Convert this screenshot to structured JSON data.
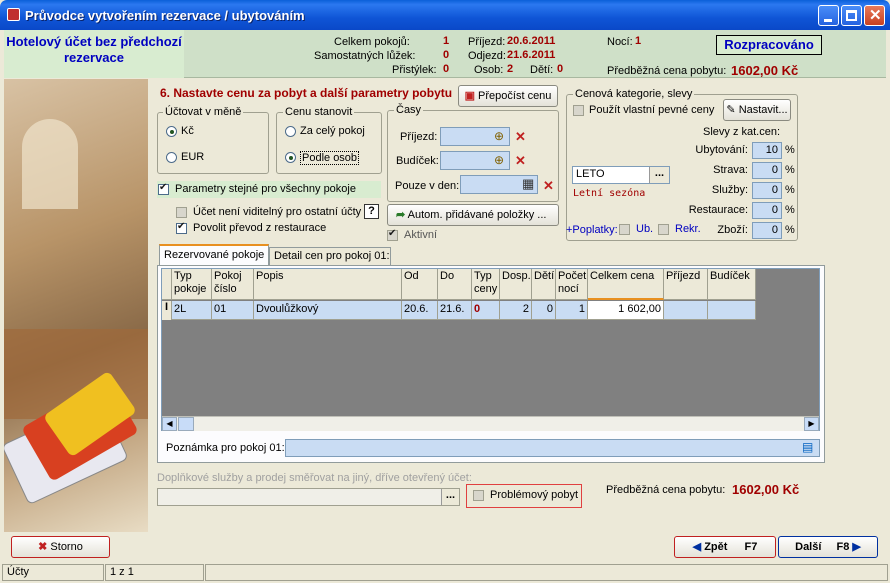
{
  "window": {
    "title": "Průvodce vytvořením rezervace / ubytováním"
  },
  "header": {
    "account_title": "Hotelový účet bez předchozí rezervace",
    "total_rooms_label": "Celkem pokojů:",
    "total_rooms": "1",
    "single_beds_label": "Samostatných lůžek:",
    "single_beds": "0",
    "extra_beds_label": "Přistýlek:",
    "extra_beds": "0",
    "arrival_label": "Příjezd:",
    "arrival": "20.6.2011",
    "departure_label": "Odjezd:",
    "departure": "21.6.2011",
    "persons_label": "Osob:",
    "persons": "2",
    "children_label": "Dětí:",
    "children": "0",
    "nights_label": "Nocí:",
    "nights": "1",
    "status": "Rozpracováno",
    "prelim_price_label": "Předběžná cena pobytu:",
    "prelim_price": "1602,00 Kč"
  },
  "step": {
    "title": "6. Nastavte cenu za pobyt a další parametry pobytu",
    "recalc_button": "Přepočíst cenu"
  },
  "currency": {
    "label": "Účtovat v měně",
    "opt1": "Kč",
    "opt2": "EUR",
    "selected": "Kč"
  },
  "price_set": {
    "label": "Cenu stanovit",
    "opt1": "Za celý pokoj",
    "opt2": "Podle osob",
    "selected": "Podle osob"
  },
  "times": {
    "label": "Časy",
    "arrival_label": "Příjezd:",
    "wakeup_label": "Budíček:",
    "only_day_label": "Pouze v den:"
  },
  "price_cat": {
    "label": "Cenová kategorie, slevy",
    "own_prices": "Použít vlastní pevné ceny",
    "settings_button": "Nastavit...",
    "code": "LETO",
    "season": "Letní sezóna",
    "discounts_label": "Slevy z kat.cen:",
    "rows": [
      {
        "label": "Ubytování:",
        "value": "10",
        "unit": "%"
      },
      {
        "label": "Strava:",
        "value": "0",
        "unit": "%"
      },
      {
        "label": "Služby:",
        "value": "0",
        "unit": "%"
      },
      {
        "label": "Restaurace:",
        "value": "0",
        "unit": "%"
      },
      {
        "label": "Zboží:",
        "value": "0",
        "unit": "%"
      }
    ],
    "fees_label": "+Poplatky:",
    "fee_ub": "Ub.",
    "fee_rekr": "Rekr."
  },
  "options": {
    "same_params": "Parametry stejné pro všechny pokoje",
    "not_visible": "Účet není viditelný pro ostatní účty",
    "allow_transfer": "Povolit převod z restaurace",
    "auto_items_button": "Autom. přidávané položky ...",
    "active": "Aktivní"
  },
  "tabs": {
    "reserved": "Rezervované pokoje",
    "detail": "Detail cen pro pokoj 01:"
  },
  "grid": {
    "headers": [
      "Typ pokoje",
      "Pokoj číslo",
      "Popis",
      "Od",
      "Do",
      "Typ ceny",
      "Dosp.",
      "Dětí",
      "Počet nocí",
      "Celkem cena",
      "Příjezd",
      "Budíček"
    ],
    "row": [
      "2L",
      "01",
      "Dvoulůžkový",
      "20.6.",
      "21.6.",
      "0",
      "2",
      "0",
      "1",
      "1 602,00",
      "",
      ""
    ]
  },
  "note_label": "Poznámka pro pokoj 01:",
  "extra_services_label": "Doplňkové služby a prodej směřovat na jiný, dříve otevřený účet:",
  "problem_stay": "Problémový pobyt",
  "footer_price_label": "Předběžná cena pobytu:",
  "footer_price": "1602,00 Kč",
  "buttons": {
    "cancel": "Storno",
    "back": "Zpět",
    "back_key": "F7",
    "next": "Další",
    "next_key": "F8"
  },
  "statusbar": {
    "module": "Účty",
    "pager": "1 z 1"
  },
  "colors": {
    "accent_red": "#a00000",
    "field_blue": "#c9dcf3",
    "header_green": "#cfe0c8"
  }
}
